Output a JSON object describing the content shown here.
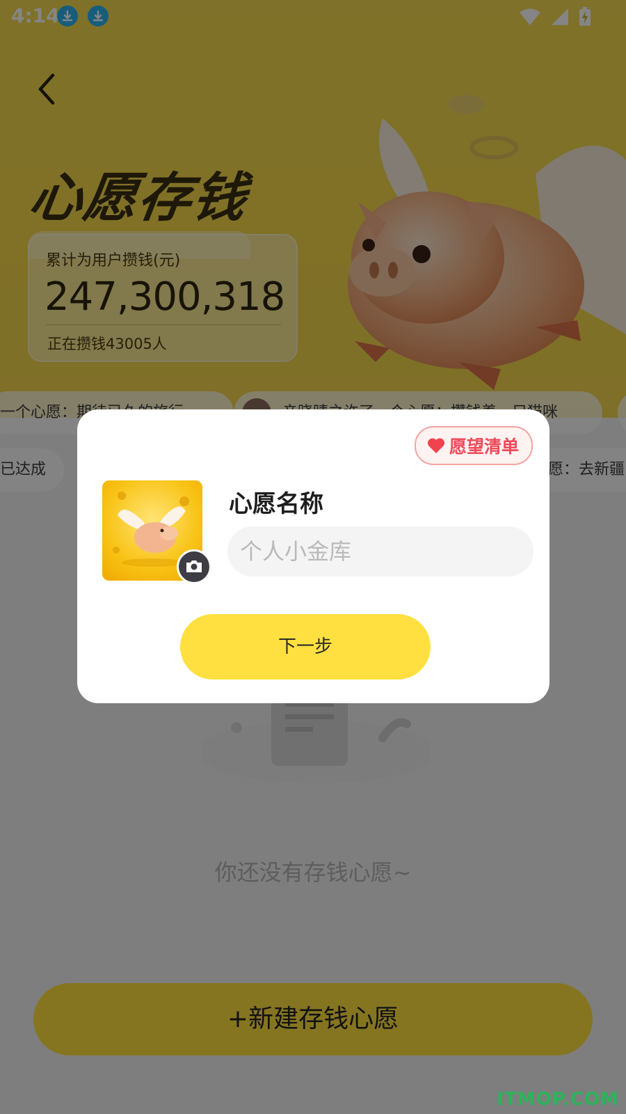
{
  "status_bar": {
    "time": "4:14"
  },
  "header": {
    "title": "心愿存钱"
  },
  "stats": {
    "label": "累计为用户攒钱(元)",
    "total": "247,300,318",
    "saving_now": "正在攒钱43005人"
  },
  "marquee": {
    "row1": [
      "一个心愿：期待已久的旅行",
      "亲晓晴之许了一个心愿：攒钱养一只猫咪"
    ],
    "row2": [
      "已达成",
      "愿：去新疆"
    ]
  },
  "empty_state": {
    "text": "你还没有存钱心愿~"
  },
  "bottom_button": {
    "label": "+新建存钱心愿"
  },
  "dialog": {
    "wish_list_label": "愿望清单",
    "name_label": "心愿名称",
    "name_placeholder": "个人小金库",
    "next_label": "下一步"
  },
  "watermark": "ITMOP.COM",
  "colors": {
    "accent_yellow": "#ffe040",
    "wish_red": "#f0495a",
    "hero_yellow": "#f3d94f"
  }
}
